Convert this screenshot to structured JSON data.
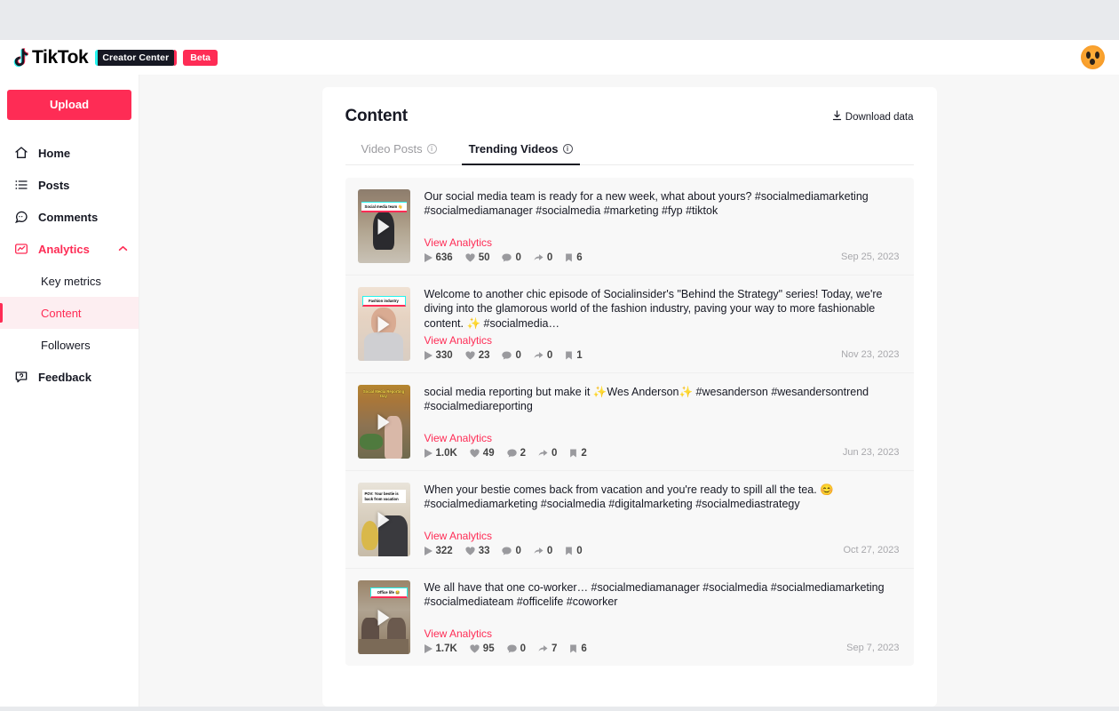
{
  "header": {
    "logo_icon": "tiktok-note-icon",
    "wordmark": "TikTok",
    "creator_center_badge": "Creator Center",
    "beta_badge": "Beta",
    "avatar_icon": "user-avatar"
  },
  "sidebar": {
    "upload_label": "Upload",
    "items": [
      {
        "label": "Home",
        "icon": "home-icon",
        "active": false
      },
      {
        "label": "Posts",
        "icon": "list-icon",
        "active": false
      },
      {
        "label": "Comments",
        "icon": "comment-icon",
        "active": false
      },
      {
        "label": "Analytics",
        "icon": "analytics-icon",
        "active": true,
        "expanded": true,
        "chevron": "chevron-up-icon"
      },
      {
        "label": "Feedback",
        "icon": "feedback-icon",
        "active": false
      }
    ],
    "sub_items": [
      {
        "label": "Key metrics",
        "active": false
      },
      {
        "label": "Content",
        "active": true
      },
      {
        "label": "Followers",
        "active": false
      }
    ]
  },
  "main": {
    "title": "Content",
    "download_label": "Download data",
    "download_icon": "download-icon",
    "tabs": [
      {
        "label": "Video Posts",
        "active": false,
        "info_icon": "info-icon"
      },
      {
        "label": "Trending Videos",
        "active": true,
        "info_icon": "info-icon"
      }
    ],
    "view_analytics_label": "View Analytics",
    "stat_icons": [
      "play-icon",
      "heart-icon",
      "comment-icon",
      "share-icon",
      "bookmark-icon"
    ],
    "videos": [
      {
        "caption": "Our social media team is ready for a new week, what about yours? #socialmediamarketing #socialmediamanager #socialmedia #marketing #fyp #tiktok",
        "thumb_overlay": "Social media team 👋",
        "plays": "636",
        "likes": "50",
        "comments": "0",
        "shares": "0",
        "bookmarks": "6",
        "date": "Sep 25, 2023"
      },
      {
        "caption": "Welcome to another chic episode of Socialinsider's \"Behind the Strategy\" series! Today, we're diving into the glamorous world of the fashion industry, paving your way to more fashionable content. ✨ #socialmedia…",
        "thumb_overlay": "Fashion industry",
        "plays": "330",
        "likes": "23",
        "comments": "0",
        "shares": "0",
        "bookmarks": "1",
        "date": "Nov 23, 2023"
      },
      {
        "caption": "social media reporting but make it ✨Wes Anderson✨ #wesanderson #wesandersontrend #socialmediareporting",
        "thumb_overlay": "Social Media Reporting Day",
        "plays": "1.0K",
        "likes": "49",
        "comments": "2",
        "shares": "0",
        "bookmarks": "2",
        "date": "Jun 23, 2023"
      },
      {
        "caption": "When your bestie comes back from vacation and you're ready to spill all the tea. 😊 #socialmediamarketing #socialmedia #digitalmarketing #socialmediastrategy",
        "thumb_overlay": "POV: Your bestie is back from vacation",
        "plays": "322",
        "likes": "33",
        "comments": "0",
        "shares": "0",
        "bookmarks": "0",
        "date": "Oct 27, 2023"
      },
      {
        "caption": "We all have that one co-worker… #socialmediamanager #socialmedia #socialmediamarketing #socialmediateam #officelife #coworker",
        "thumb_overlay": "Office life 😂",
        "plays": "1.7K",
        "likes": "95",
        "comments": "0",
        "shares": "7",
        "bookmarks": "6",
        "date": "Sep 7, 2023"
      }
    ]
  },
  "colors": {
    "accent": "#fe2c55",
    "cyan": "#25f4ee",
    "dark": "#161823",
    "page_bg": "#e8eaed"
  }
}
